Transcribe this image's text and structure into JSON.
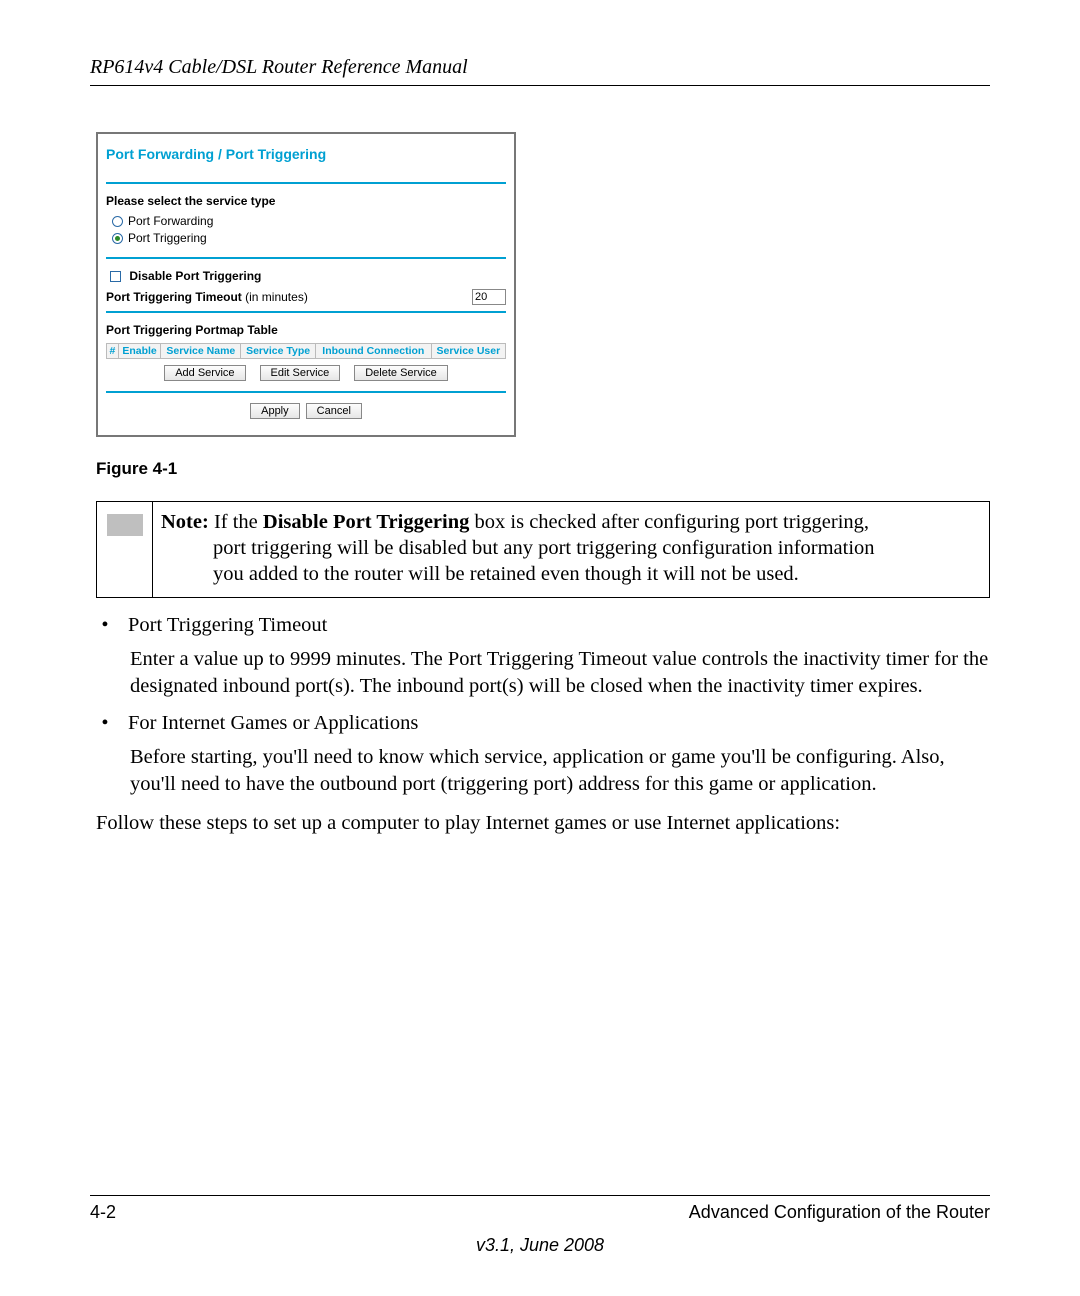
{
  "header": {
    "title": "RP614v4 Cable/DSL Router Reference Manual"
  },
  "router_ui": {
    "title": "Port Forwarding / Port Triggering",
    "service_type_label": "Please select the service type",
    "radio": {
      "forwarding": "Port Forwarding",
      "triggering": "Port Triggering",
      "selected": "triggering"
    },
    "disable_label": "Disable Port Triggering",
    "timeout_label_bold": "Port Triggering Timeout",
    "timeout_label_rest": " (in minutes)",
    "timeout_value": "20",
    "portmap_label": "Port Triggering Portmap Table",
    "table_headers": [
      "#",
      "Enable",
      "Service Name",
      "Service Type",
      "Inbound Connection",
      "Service User"
    ],
    "buttons": {
      "add": "Add Service",
      "edit": "Edit Service",
      "delete": "Delete Service",
      "apply": "Apply",
      "cancel": "Cancel"
    }
  },
  "figure_caption": "Figure 4-1",
  "note": {
    "prefix": "Note:",
    "line1_rest_a": " If the ",
    "bold_inline": "Disable Port Triggering",
    "line1_rest_b": " box is checked after configuring port triggering,",
    "line2": "port triggering will be disabled but any port triggering configuration information",
    "line3": "you added to the router will be retained even though it will not be used."
  },
  "bullets": [
    {
      "title": "Port Triggering Timeout",
      "body": "Enter a value up to 9999 minutes. The Port Triggering Timeout value controls the inactivity timer for the designated inbound port(s). The inbound port(s) will be closed when the inactivity timer expires."
    },
    {
      "title": "For Internet Games or Applications",
      "body": "Before starting, you'll need to know which service, application or game you'll be configuring. Also, you'll need to have the outbound port (triggering port) address for this game or application."
    }
  ],
  "follow_line": "Follow these steps to set up a computer to play Internet games or use Internet applications:",
  "footer": {
    "page": "4-2",
    "section": "Advanced Configuration of the Router",
    "version": "v3.1, June 2008"
  }
}
